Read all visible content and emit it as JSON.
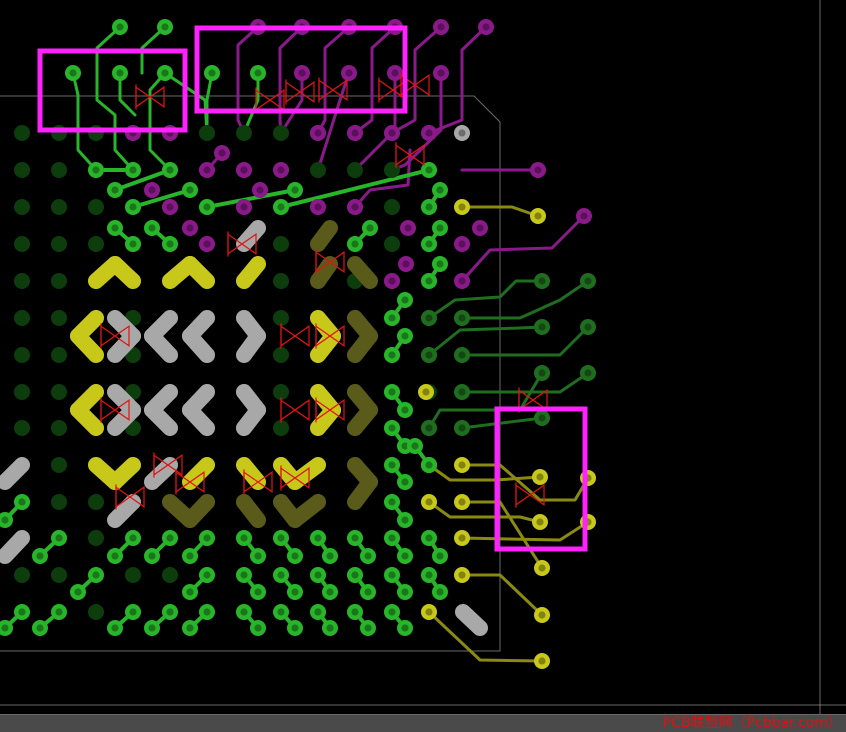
{
  "colors": {
    "background": "#000000",
    "green_bright": "#29b52a",
    "green_dark": "#0d3d0d",
    "green_mid": "#1f6e1f",
    "purple": "#8a1a8a",
    "yellow": "#c8c81a",
    "olive": "#8a8a12",
    "gray": "#a8a8a8",
    "magenta_box": "#ff22ff",
    "drc_red": "#e01414",
    "outline": "#b0b0b0",
    "statusbar": "#4a4a4a"
  },
  "statusbar": {
    "watermark": "PCB联盟网（Pcbbar.com）"
  }
}
